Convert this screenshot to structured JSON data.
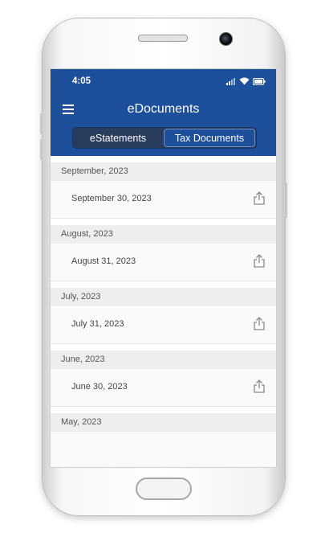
{
  "status_bar": {
    "time": "4:05"
  },
  "header": {
    "title": "eDocuments"
  },
  "tabs": [
    {
      "label": "eStatements",
      "active": false
    },
    {
      "label": "Tax Documents",
      "active": true
    }
  ],
  "sections": [
    {
      "header": "September, 2023",
      "items": [
        "September 30, 2023"
      ]
    },
    {
      "header": "August, 2023",
      "items": [
        "August 31, 2023"
      ]
    },
    {
      "header": "July, 2023",
      "items": [
        "July 31, 2023"
      ]
    },
    {
      "header": "June, 2023",
      "items": [
        "June 30, 2023"
      ]
    },
    {
      "header": "May, 2023",
      "items": []
    }
  ],
  "colors": {
    "appbar": "#1d4f9b",
    "segment_bg": "#2a3c5e",
    "section_bg": "#eeeeee"
  },
  "icons": {
    "menu": "hamburger-menu-icon",
    "share": "share-icon",
    "wifi": "wifi-icon",
    "signal": "signal-icon",
    "battery": "battery-icon"
  }
}
